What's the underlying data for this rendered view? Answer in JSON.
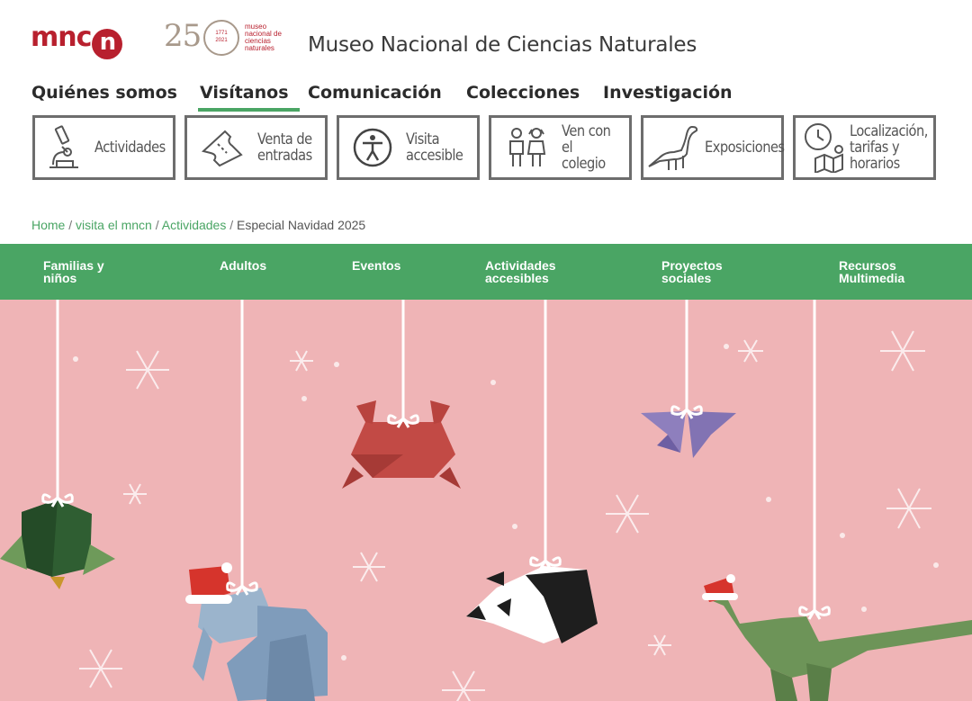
{
  "header": {
    "logo_text": "mnc",
    "logo_n": "n",
    "anniversary_number": "25",
    "anniversary_years": "1771\n2021",
    "anniversary_small": "museo\nnacional de\nciencias\nnaturales",
    "site_title": "Museo Nacional de Ciencias Naturales"
  },
  "main_nav": [
    {
      "label": "Quiénes somos",
      "active": false
    },
    {
      "label": "Visítanos",
      "active": true
    },
    {
      "label": "Comunicación",
      "active": false
    },
    {
      "label": "Colecciones",
      "active": false
    },
    {
      "label": "Investigación",
      "active": false
    }
  ],
  "tiles": [
    {
      "label": "Actividades",
      "icon": "microscope-icon"
    },
    {
      "label": "Venta de\nentradas",
      "icon": "ticket-icon"
    },
    {
      "label": "Visita\naccesible",
      "icon": "accessibility-icon"
    },
    {
      "label": "Ven con\nel colegio",
      "icon": "children-icon"
    },
    {
      "label": "Exposiciones",
      "icon": "dinosaur-icon"
    },
    {
      "label": "Localización,\ntarifas y\nhorarios",
      "icon": "clock-map-icon"
    }
  ],
  "breadcrumb": {
    "items": [
      "Home",
      "visita el mncn",
      "Actividades"
    ],
    "separator": " / ",
    "current": "Especial Navidad 2025"
  },
  "sub_nav": [
    "Familias y\nniños",
    "Adultos",
    "Eventos",
    "Actividades\naccesibles",
    "Proyectos\nsociales",
    "Recursos\nMultimedia"
  ],
  "colors": {
    "brand_red": "#b8202e",
    "accent_green": "#4aa564",
    "hero_pink": "#efb4b6",
    "tile_border": "#6d6d6d"
  }
}
